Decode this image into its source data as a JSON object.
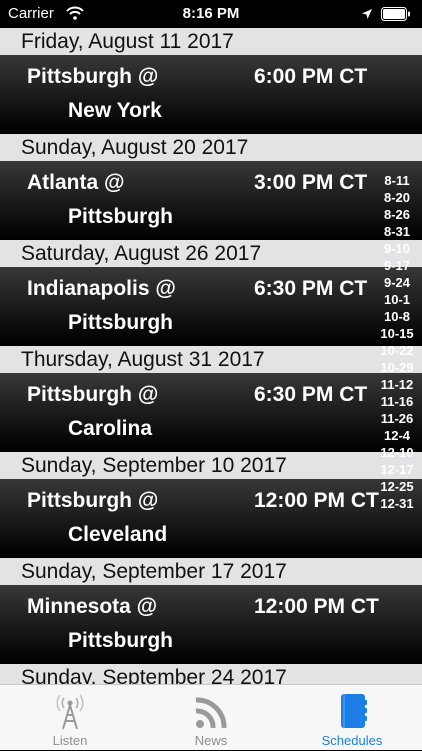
{
  "status_bar": {
    "carrier": "Carrier",
    "time": "8:16 PM"
  },
  "sections": [
    {
      "date": "Friday, August 11 2017",
      "home": "Pittsburgh @",
      "away": "New York",
      "time": "6:00 PM CT"
    },
    {
      "date": "Sunday, August 20 2017",
      "home": "Atlanta @",
      "away": "Pittsburgh",
      "time": "3:00 PM CT"
    },
    {
      "date": "Saturday, August 26 2017",
      "home": "Indianapolis @",
      "away": "Pittsburgh",
      "time": "6:30 PM CT"
    },
    {
      "date": "Thursday, August 31 2017",
      "home": "Pittsburgh @",
      "away": "Carolina",
      "time": "6:30 PM CT"
    },
    {
      "date": "Sunday, September 10 2017",
      "home": "Pittsburgh @",
      "away": "Cleveland",
      "time": "12:00 PM CT"
    },
    {
      "date": "Sunday, September 17 2017",
      "home": "Minnesota @",
      "away": "Pittsburgh",
      "time": "12:00 PM CT"
    },
    {
      "date": "Sunday, September 24 2017"
    }
  ],
  "index": [
    "8-11",
    "8-20",
    "8-26",
    "8-31",
    "9-10",
    "9-17",
    "9-24",
    "10-1",
    "10-8",
    "10-15",
    "10-22",
    "10-29",
    "11-12",
    "11-16",
    "11-26",
    "12-4",
    "12-10",
    "12-17",
    "12-25",
    "12-31"
  ],
  "tabs": [
    {
      "label": "Listen",
      "icon": "radio-tower-icon"
    },
    {
      "label": "News",
      "icon": "rss-icon"
    },
    {
      "label": "Schedules",
      "icon": "notebook-icon"
    }
  ],
  "colors": {
    "accent": "#1d7fe6",
    "section_header": "#e3e3e6"
  }
}
